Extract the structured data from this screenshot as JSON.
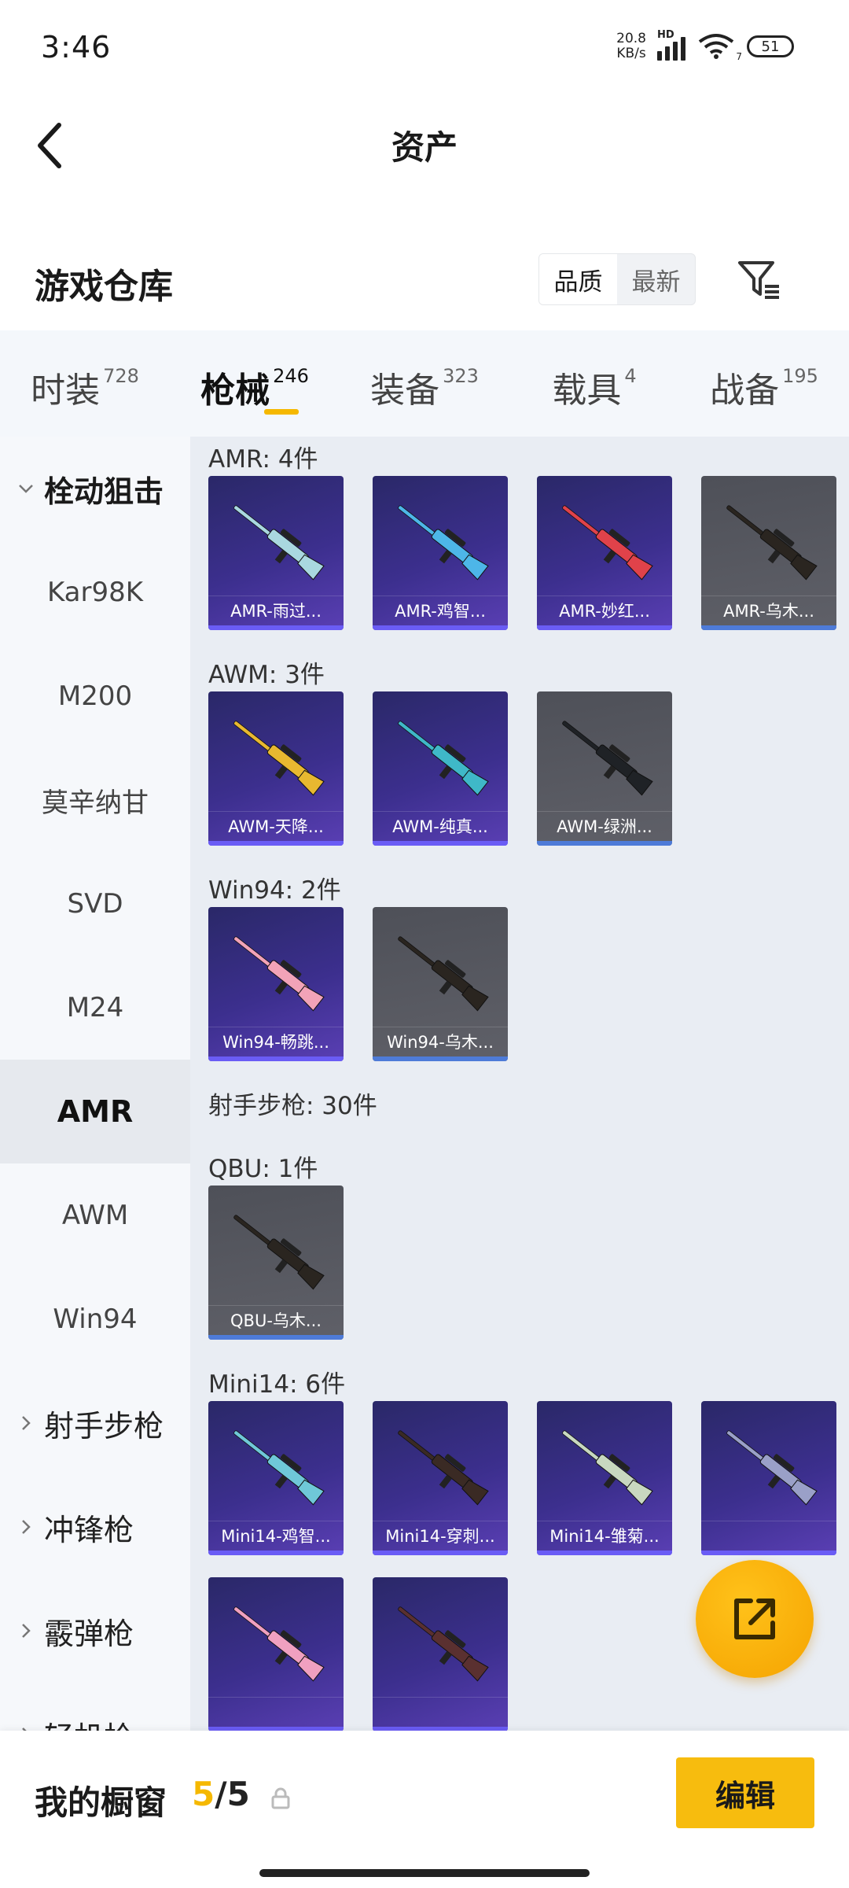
{
  "status_bar": {
    "time": "3:46",
    "net_speed_value": "20.8",
    "net_speed_unit": "KB/s",
    "network_type": "HD",
    "wifi_label": "7",
    "battery": "51"
  },
  "header": {
    "title": "资产"
  },
  "warehouse": {
    "title": "游戏仓库",
    "sort_options": [
      "品质",
      "最新"
    ],
    "active_sort": "品质"
  },
  "category_tabs": [
    {
      "name": "时装",
      "count": "728"
    },
    {
      "name": "枪械",
      "count": "246"
    },
    {
      "name": "装备",
      "count": "323"
    },
    {
      "name": "载具",
      "count": "4"
    },
    {
      "name": "战备",
      "count": "195"
    }
  ],
  "active_category": "枪械",
  "sidebar": {
    "items": [
      {
        "label": "栓动狙击",
        "type": "group",
        "expanded": true
      },
      {
        "label": "Kar98K",
        "type": "item"
      },
      {
        "label": "M200",
        "type": "item"
      },
      {
        "label": "莫辛纳甘",
        "type": "item"
      },
      {
        "label": "SVD",
        "type": "item"
      },
      {
        "label": "M24",
        "type": "item"
      },
      {
        "label": "AMR",
        "type": "item",
        "active": true
      },
      {
        "label": "AWM",
        "type": "item"
      },
      {
        "label": "Win94",
        "type": "item"
      },
      {
        "label": "射手步枪",
        "type": "group",
        "expanded": false
      },
      {
        "label": "冲锋枪",
        "type": "group",
        "expanded": false
      },
      {
        "label": "霰弹枪",
        "type": "group",
        "expanded": false
      },
      {
        "label": "轻机枪",
        "type": "group",
        "expanded": false
      }
    ]
  },
  "sections": [
    {
      "title": "AMR: 4件",
      "cards": [
        {
          "label": "AMR-雨过...",
          "bg": "purple",
          "gun_color": "#a9d8e0"
        },
        {
          "label": "AMR-鸡智...",
          "bg": "purple",
          "gun_color": "#4db6e8"
        },
        {
          "label": "AMR-妙红...",
          "bg": "purple",
          "gun_color": "#e0424a"
        },
        {
          "label": "AMR-乌木...",
          "bg": "grey",
          "gun_color": "#2a2520"
        }
      ]
    },
    {
      "title": "AWM: 3件",
      "cards": [
        {
          "label": "AWM-天降...",
          "bg": "purple",
          "gun_color": "#e8b830"
        },
        {
          "label": "AWM-纯真...",
          "bg": "purple",
          "gun_color": "#3fb8c8"
        },
        {
          "label": "AWM-绿洲...",
          "bg": "grey",
          "gun_color": "#1f2226"
        }
      ]
    },
    {
      "title": "Win94: 2件",
      "cards": [
        {
          "label": "Win94-畅跳...",
          "bg": "purple",
          "gun_color": "#f2a3b8"
        },
        {
          "label": "Win94-乌木...",
          "bg": "grey",
          "gun_color": "#2a2520"
        }
      ]
    },
    {
      "title": "射手步枪: 30件",
      "cards": []
    },
    {
      "title": "QBU: 1件",
      "cards": [
        {
          "label": "QBU-乌木...",
          "bg": "grey",
          "gun_color": "#2a2520"
        }
      ]
    },
    {
      "title": "Mini14: 6件",
      "cards": [
        {
          "label": "Mini14-鸡智...",
          "bg": "purple",
          "gun_color": "#6fc8d8"
        },
        {
          "label": "Mini14-穿刺...",
          "bg": "purple",
          "gun_color": "#3a2a24"
        },
        {
          "label": "Mini14-雏菊...",
          "bg": "purple",
          "gun_color": "#c8d8c0"
        },
        {
          "label": "",
          "bg": "purple",
          "gun_color": "#9aa0c8"
        },
        {
          "label": "",
          "bg": "purple",
          "gun_color": "#f0a0c0"
        },
        {
          "label": "",
          "bg": "purple",
          "gun_color": "#5a3030"
        }
      ]
    }
  ],
  "bottom_bar": {
    "showcase_label": "我的橱窗",
    "showcase_used": "5",
    "showcase_separator": "/",
    "showcase_total": "5",
    "edit_label": "编辑"
  },
  "colors": {
    "accent": "#f5b800",
    "card_purple": "#3c2f8e",
    "card_grey": "#5a5b62"
  },
  "icons": {
    "back": "back-arrow-icon",
    "filter": "filter-icon",
    "lock": "lock-icon",
    "share": "share-external-icon",
    "chevron_down": "chevron-down-icon",
    "chevron_right": "chevron-right-icon"
  }
}
